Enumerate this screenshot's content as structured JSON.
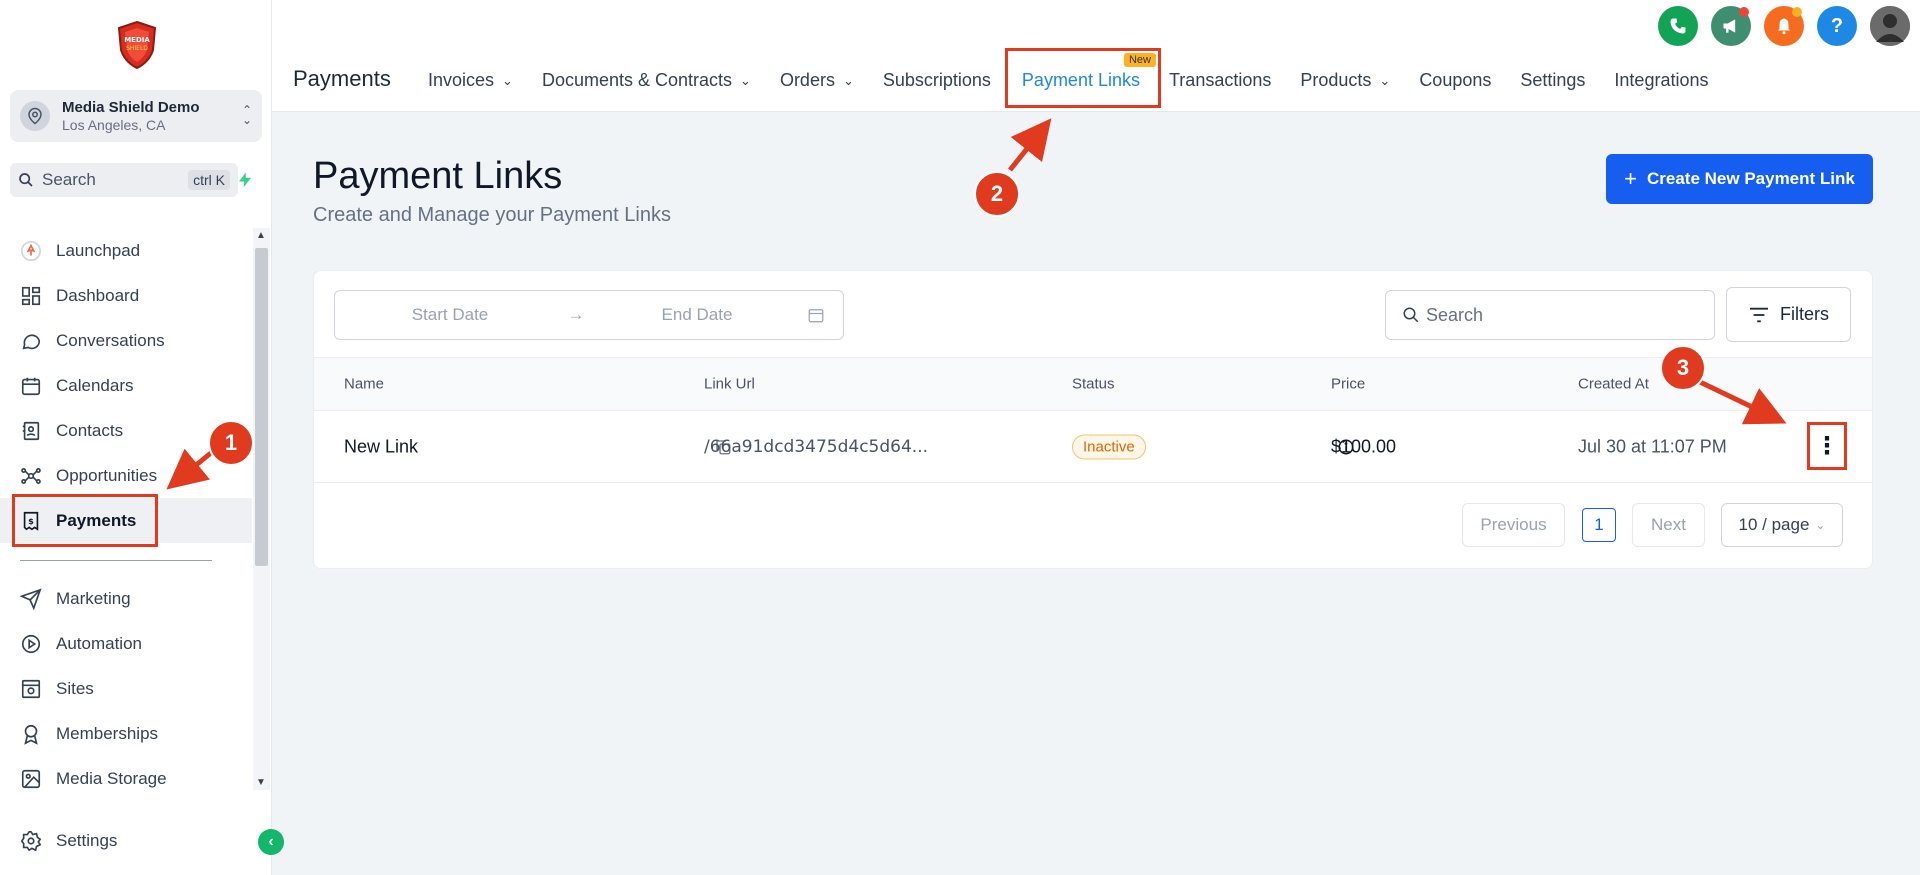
{
  "sidebar": {
    "account": {
      "name": "Media Shield Demo",
      "location": "Los Angeles, CA"
    },
    "logo_text": "MEDIA SHIELD",
    "search": {
      "label": "Search",
      "shortcut": "ctrl K"
    },
    "items": [
      {
        "label": "Launchpad",
        "icon": "rocket-icon"
      },
      {
        "label": "Dashboard",
        "icon": "grid-icon"
      },
      {
        "label": "Conversations",
        "icon": "chat-icon"
      },
      {
        "label": "Calendars",
        "icon": "calendar-icon"
      },
      {
        "label": "Contacts",
        "icon": "contacts-icon"
      },
      {
        "label": "Opportunities",
        "icon": "opportunities-icon"
      },
      {
        "label": "Payments",
        "icon": "payments-icon",
        "active": true
      },
      {
        "label": "Marketing",
        "icon": "send-icon"
      },
      {
        "label": "Automation",
        "icon": "automation-icon"
      },
      {
        "label": "Sites",
        "icon": "sites-icon"
      },
      {
        "label": "Memberships",
        "icon": "badge-icon"
      },
      {
        "label": "Media Storage",
        "icon": "image-icon"
      }
    ],
    "settings_label": "Settings"
  },
  "header": {
    "section_title": "Payments",
    "tabs": [
      {
        "label": "Invoices",
        "dropdown": true
      },
      {
        "label": "Documents & Contracts",
        "dropdown": true
      },
      {
        "label": "Orders",
        "dropdown": true
      },
      {
        "label": "Subscriptions"
      },
      {
        "label": "Payment Links",
        "active": true,
        "badge": "New"
      },
      {
        "label": "Transactions"
      },
      {
        "label": "Products",
        "dropdown": true
      },
      {
        "label": "Coupons"
      },
      {
        "label": "Settings"
      },
      {
        "label": "Integrations"
      }
    ],
    "icons": [
      {
        "name": "phone-icon",
        "color": "#12a454"
      },
      {
        "name": "megaphone-icon",
        "color": "#3e8f72"
      },
      {
        "name": "bell-icon",
        "color": "#f56b1f"
      },
      {
        "name": "help-icon",
        "color": "#1e88e5",
        "glyph": "?"
      },
      {
        "name": "user-avatar",
        "color": "#5b5b5b"
      }
    ]
  },
  "main": {
    "title": "Payment Links",
    "subtitle": "Create and Manage your Payment Links",
    "create_button": "Create New Payment Link",
    "filters": {
      "start_placeholder": "Start Date",
      "end_placeholder": "End Date",
      "search_placeholder": "Search",
      "filters_label": "Filters"
    },
    "table": {
      "columns": [
        "Name",
        "Link Url",
        "Status",
        "Price",
        "Created At"
      ],
      "rows": [
        {
          "name": "New Link",
          "url": "/66a91dcd3475d4c5d64...",
          "status": "Inactive",
          "price": "$100.00",
          "created": "Jul 30 at 11:07 PM"
        }
      ]
    },
    "pagination": {
      "previous": "Previous",
      "page": "1",
      "next": "Next",
      "page_size": "10 / page"
    }
  },
  "annotations": {
    "step1": "1",
    "step2": "2",
    "step3": "3",
    "color": "#e03a1f"
  }
}
